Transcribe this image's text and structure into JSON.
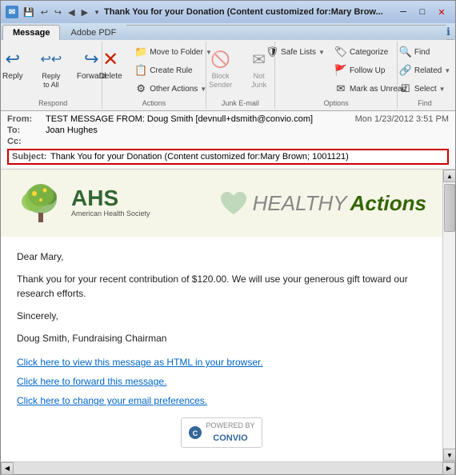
{
  "window": {
    "title": "Thank You for your Donation (Content customized for:Mary Brow...",
    "icon": "✉"
  },
  "titlebar": {
    "minimize": "─",
    "maximize": "□",
    "close": "✕",
    "quicktoolbar": [
      "↩",
      "↩",
      "↩",
      "▶",
      "▼"
    ]
  },
  "ribbon": {
    "tabs": [
      {
        "label": "Message",
        "active": true
      },
      {
        "label": "Adobe PDF",
        "active": false
      }
    ],
    "groups": {
      "respond": {
        "label": "Respond",
        "buttons": [
          {
            "id": "reply",
            "label": "Reply",
            "icon": "↩"
          },
          {
            "id": "reply-all",
            "label": "Reply\nto All",
            "icon": "↩↩"
          },
          {
            "id": "forward",
            "label": "Forward",
            "icon": "↪"
          }
        ]
      },
      "actions": {
        "label": "Actions",
        "small_buttons": [
          {
            "id": "move-to-folder",
            "label": "Move to Folder ▼",
            "icon": "📁"
          },
          {
            "id": "create-rule",
            "label": "Create Rule",
            "icon": "📋"
          },
          {
            "id": "other-actions",
            "label": "Other Actions ▼",
            "icon": "⚙"
          },
          {
            "id": "delete",
            "label": "Delete",
            "icon": "✕"
          }
        ]
      },
      "junk": {
        "label": "Junk E-mail",
        "small_buttons": [
          {
            "id": "block-sender",
            "label": "Block\nSender",
            "icon": "🚫"
          },
          {
            "id": "not-junk",
            "label": "Not Junk",
            "icon": "✉"
          }
        ]
      },
      "options": {
        "label": "Options",
        "small_buttons": [
          {
            "id": "safe-lists",
            "label": "Safe Lists ▼",
            "icon": "🛡"
          },
          {
            "id": "categorize",
            "label": "Categorize",
            "icon": "🏷"
          },
          {
            "id": "follow-up",
            "label": "Follow\nUp",
            "icon": "🚩"
          },
          {
            "id": "mark-unread",
            "label": "Mark as\nUnread",
            "icon": "✉"
          }
        ]
      },
      "find": {
        "label": "Find",
        "small_buttons": [
          {
            "id": "find",
            "label": "Find",
            "icon": "🔍"
          },
          {
            "id": "related",
            "label": "Related ▼",
            "icon": "🔗"
          },
          {
            "id": "select",
            "label": "Select ▼",
            "icon": "☑"
          }
        ]
      }
    }
  },
  "email": {
    "from": "TEST MESSAGE FROM: Doug Smith [devnull+dsmith@convio.com]",
    "to": "Joan Hughes",
    "cc": "",
    "subject": "Thank You for your Donation (Content customized for:Mary Brown; 1001121)",
    "sent": "Mon 1/23/2012 3:51 PM",
    "body": {
      "greeting": "Dear Mary,",
      "paragraph1": "Thank you for your recent contribution of $120.00. We will use your generous gift toward our research efforts.",
      "closing": "Sincerely,",
      "signature": "Doug Smith, Fundraising Chairman",
      "link1": "Click here to view this message as HTML in your browser.",
      "link2": "Click here to forward this message.",
      "link3": "Click here to change your email preferences.",
      "powered_by": "POWERED BY",
      "brand": "CONVIO"
    },
    "banner": {
      "org_abbr": "AHS",
      "org_full": "American Health Society",
      "tagline_light": "HEALTHY",
      "tagline_bold": "Actions"
    }
  }
}
